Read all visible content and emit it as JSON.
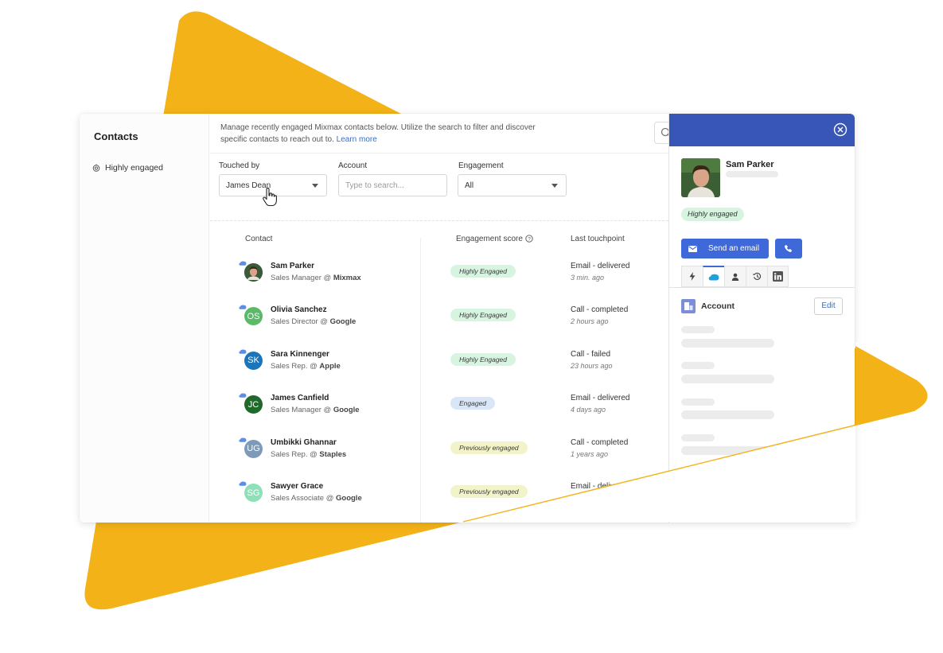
{
  "colors": {
    "background_shape": "#F3B217",
    "panel_header": "#3856B7",
    "primary_button": "#3F69D9",
    "link": "#2F6FD6",
    "badge_highly_engaged": "#D7F4E1",
    "badge_engaged": "#D9E6F7",
    "badge_previously_engaged": "#F3F3C9"
  },
  "sidebar": {
    "title": "Contacts",
    "items": [
      {
        "label": "Highly engaged",
        "icon": "segment-icon"
      }
    ]
  },
  "main": {
    "description": "Manage recently engaged Mixmax contacts below. Utilize the search to filter and discover specific contacts to reach out to.",
    "learn_more": "Learn more",
    "filters": {
      "touched_by": {
        "label": "Touched by",
        "value": "James Dean"
      },
      "account": {
        "label": "Account",
        "placeholder": "Type to search..."
      },
      "engagement": {
        "label": "Engagement",
        "value": "All"
      }
    },
    "columns": {
      "contact": "Contact",
      "engagement_score": "Engagement score",
      "last_touchpoint": "Last touchpoint"
    },
    "contacts": [
      {
        "name": "Sam Parker",
        "title": "Sales Manager @",
        "company": "Mixmax",
        "initials": "",
        "avatar_color": "#3a5a3a",
        "engagement": "Highly Engaged",
        "touchpoint": "Email - delivered",
        "time": "3 min. ago"
      },
      {
        "name": "Olivia Sanchez",
        "title": "Sales Director @",
        "company": "Google",
        "initials": "OS",
        "avatar_color": "#5cb96a",
        "engagement": "Highly Engaged",
        "touchpoint": "Call - completed",
        "time": "2 hours ago"
      },
      {
        "name": "Sara Kinnenger",
        "title": "Sales Rep. @",
        "company": "Apple",
        "initials": "SK",
        "avatar_color": "#1b75b9",
        "engagement": "Highly Engaged",
        "touchpoint": "Call - failed",
        "time": "23 hours ago"
      },
      {
        "name": "James Canfield",
        "title": "Sales Manager @",
        "company": "Google",
        "initials": "JC",
        "avatar_color": "#1f6a2b",
        "engagement": "Engaged",
        "touchpoint": "Email - delivered",
        "time": "4 days ago"
      },
      {
        "name": "Umbikki Ghannar",
        "title": "Sales Rep. @",
        "company": "Staples",
        "initials": "UG",
        "avatar_color": "#7d9ab8",
        "engagement": "Previously engaged",
        "touchpoint": "Call - completed",
        "time": "1 years ago"
      },
      {
        "name": "Sawyer Grace",
        "title": "Sales Associate @",
        "company": "Google",
        "initials": "SG",
        "avatar_color": "#8ee0b8",
        "engagement": "Previously engaged",
        "touchpoint": "Email - deliv",
        "time": ""
      }
    ]
  },
  "panel": {
    "name": "Sam Parker",
    "badge": "Highly engaged",
    "send_email": "Send an email",
    "tabs": [
      "bolt-icon",
      "salesforce-icon",
      "person-icon",
      "history-icon",
      "linkedin-icon"
    ],
    "account_title": "Account",
    "edit": "Edit"
  }
}
